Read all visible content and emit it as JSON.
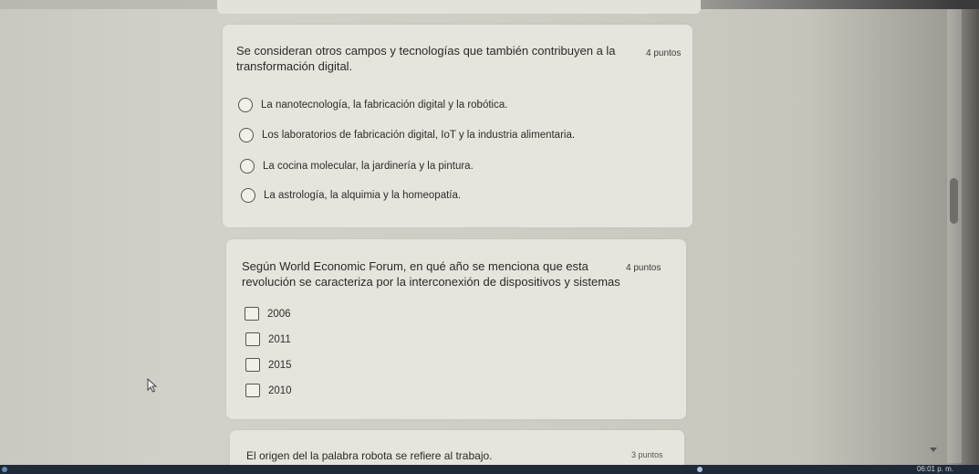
{
  "question1": {
    "text": "Se consideran otros campos y tecnologías que también contribuyen a la transformación digital.",
    "points": "4 puntos",
    "options": [
      "La nanotecnología, la fabricación digital y la robótica.",
      "Los laboratorios de fabricación digital, IoT y la industria alimentaria.",
      "La cocina molecular, la jardinería y la pintura.",
      "La astrología, la alquimia y la homeopatía."
    ]
  },
  "question2": {
    "text": "Según World Economic Forum, en qué año se menciona que esta revolución se caracteriza por la interconexión de dispositivos y sistemas",
    "points": "4 puntos",
    "options": [
      "2006",
      "2011",
      "2015",
      "2010"
    ]
  },
  "question3": {
    "text": "El origen del la palabra robota se refiere al trabajo.",
    "points": "3 puntos"
  },
  "taskbar": {
    "time": "06:01 p. m."
  },
  "colors": {
    "card_bg": "#e6e4dc",
    "page_bg": "#cfcec5",
    "taskbar": "#1f2a38"
  }
}
